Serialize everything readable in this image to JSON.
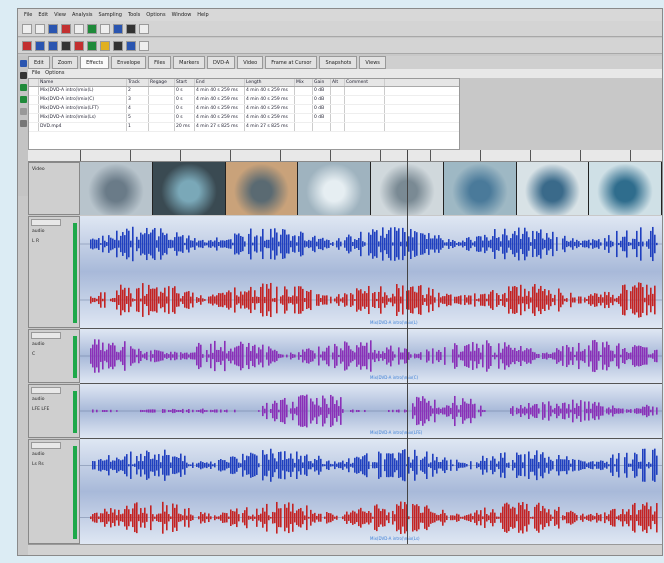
{
  "menu": {
    "items": [
      "File",
      "Edit",
      "View",
      "Analysis",
      "Sampling",
      "Tools",
      "Options",
      "Window",
      "Help"
    ]
  },
  "tabs": [
    {
      "label": "Edit",
      "active": false
    },
    {
      "label": "Zoom",
      "active": false
    },
    {
      "label": "Effects",
      "active": true
    },
    {
      "label": "Envelope",
      "active": false
    },
    {
      "label": "Files",
      "active": false
    },
    {
      "label": "Markers",
      "active": false
    },
    {
      "label": "DVD-A",
      "active": false
    },
    {
      "label": "Video",
      "active": false
    },
    {
      "label": "Frame at Cursor",
      "active": false
    },
    {
      "label": "Snapshots",
      "active": false
    },
    {
      "label": "Views",
      "active": false
    }
  ],
  "subbar": {
    "items": [
      "File",
      "Options"
    ]
  },
  "table": {
    "columns": [
      "",
      "Name",
      "Track",
      "Regage",
      "Start",
      "End",
      "Length",
      "Mix",
      "Gain",
      "Alt",
      "Comment"
    ],
    "rows": [
      [
        "",
        "Mix(DVD-A intro)\\mix(L)",
        "2",
        "",
        "0 s",
        "4 min 40 s 259 ms",
        "4 min 40 s 259 ms",
        "",
        "0 dB",
        "",
        ""
      ],
      [
        "",
        "Mix(DVD-A intro)\\mix(C)",
        "3",
        "",
        "0 s",
        "4 min 40 s 259 ms",
        "4 min 40 s 259 ms",
        "",
        "0 dB",
        "",
        ""
      ],
      [
        "",
        "Mix(DVD-A intro)\\mix(LFT)",
        "4",
        "",
        "0 s",
        "4 min 40 s 259 ms",
        "4 min 40 s 259 ms",
        "",
        "0 dB",
        "",
        ""
      ],
      [
        "",
        "Mix(DVD-A intro)\\mix(Ls)",
        "5",
        "",
        "0 s",
        "4 min 40 s 259 ms",
        "4 min 40 s 259 ms",
        "",
        "0 dB",
        "",
        ""
      ],
      [
        "",
        "DVD.mp4",
        "1",
        "",
        "20 ms",
        "4 min 27 s 825 ms",
        "4 min 27 s 825 ms",
        "",
        "",
        "",
        ""
      ]
    ]
  },
  "video_track": {
    "label": "Video"
  },
  "tracks": [
    {
      "name": "audio",
      "mode": "L R",
      "color": "#1f3fbf",
      "clip": "Mix(DVD-A intro)\\mix(L)"
    },
    {
      "name": "audio",
      "mode": "C",
      "color": "#8a2fb8",
      "clip": "Mix(DVD-A intro)\\mix(C)"
    },
    {
      "name": "audio",
      "mode": "LFE  LFE",
      "color": "#7a2aa8",
      "clip": "Mix(DVD-A intro)\\mix(LFE)"
    },
    {
      "name": "audio",
      "mode": "Ls  Rs",
      "color": "#1f3fbf",
      "clip": "Mix(DVD-A intro)\\mix(Ls)"
    }
  ],
  "colors": {
    "blue_wave": "#1f3fbf",
    "red_wave": "#c42222",
    "purple_wave": "#8a2fb8",
    "level_meter": "#1ea84a"
  },
  "icons": [
    "new-file-icon",
    "open-icon",
    "save-icon",
    "cut-icon",
    "play-icon",
    "stop-icon",
    "record-icon",
    "rewind-icon",
    "fast-forward-icon"
  ]
}
